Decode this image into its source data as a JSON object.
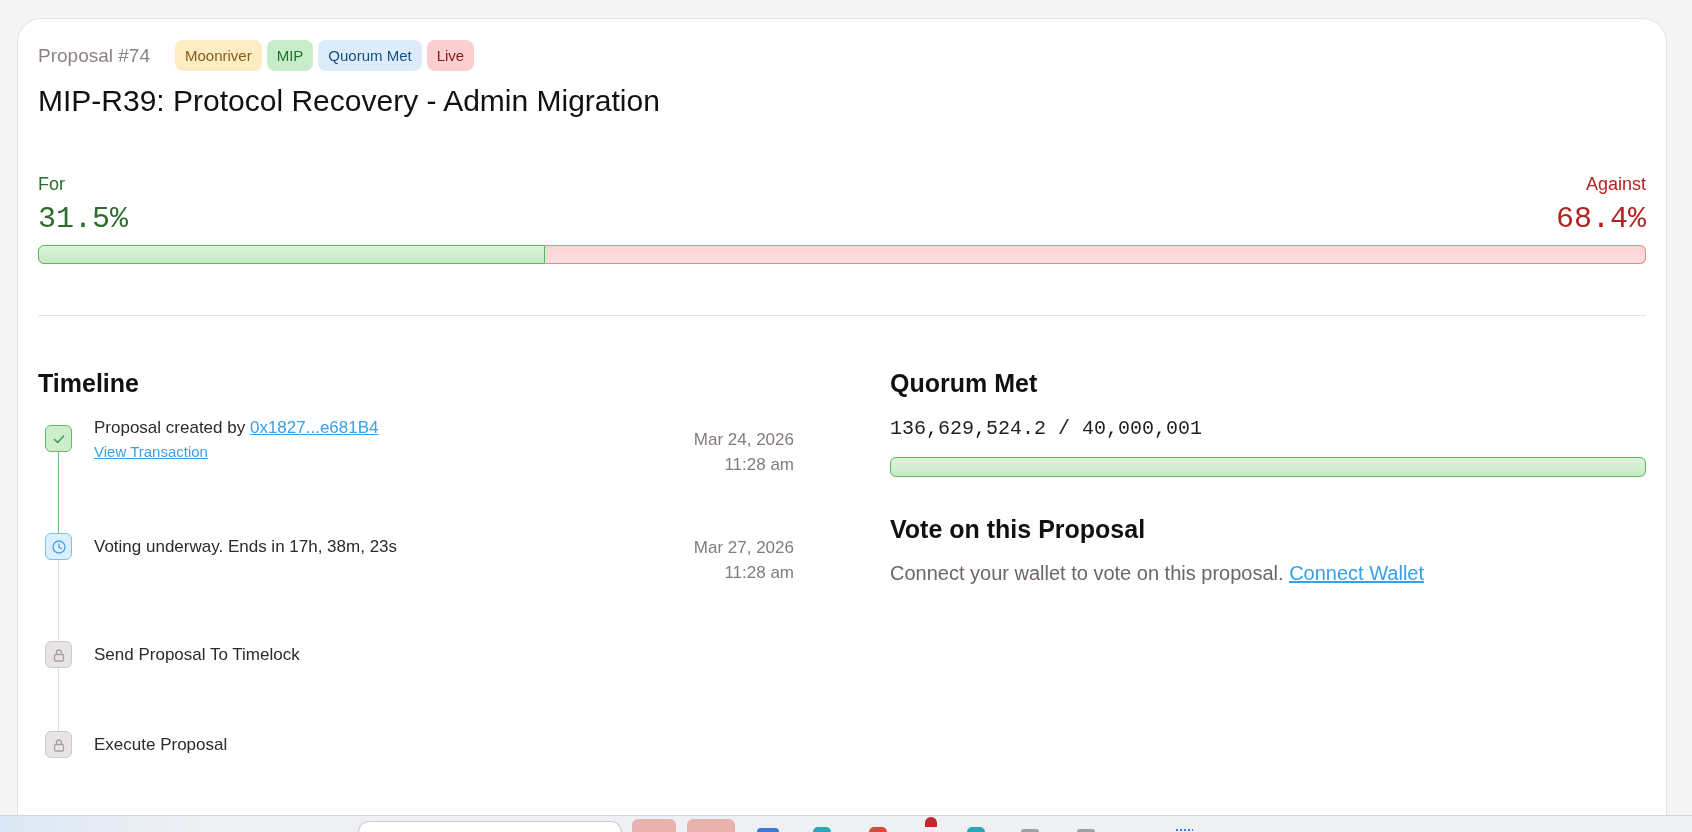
{
  "header": {
    "proposal_number": "Proposal #74",
    "tags": [
      {
        "label": "Moonriver",
        "color": "#fdebc4"
      },
      {
        "label": "MIP",
        "color": "#c6ecc9"
      },
      {
        "label": "Quorum Met",
        "color": "#dcecfb"
      },
      {
        "label": "Live",
        "color": "#fbcfcf"
      }
    ],
    "title": "MIP-R39: Protocol Recovery - Admin Migration"
  },
  "votes": {
    "for": {
      "label": "For",
      "percent": "31.5%",
      "level": 0.315
    },
    "against": {
      "label": "Against",
      "percent": "68.4%",
      "level": 0.684
    }
  },
  "timeline": {
    "title": "Timeline",
    "steps": [
      {
        "kind": "done",
        "text": "Proposal created by",
        "link": "0x1827...e681B4",
        "sublink": "View Transaction",
        "date": "Mar 24, 2026",
        "time": "11:28 am"
      },
      {
        "kind": "active",
        "text": "Voting underway. Ends in 17h, 38m, 23s",
        "date": "Mar 27, 2026",
        "time": "11:28 am"
      },
      {
        "kind": "locked",
        "text": "Send Proposal To Timelock"
      },
      {
        "kind": "locked",
        "text": "Execute Proposal"
      }
    ]
  },
  "quorum": {
    "title": "Quorum Met",
    "reading": "136,629,524.2 / 40,000,001",
    "level": 1
  },
  "vote": {
    "title": "Vote on this Proposal",
    "text": "Connect your wallet to vote on this proposal.",
    "link": "Connect Wallet"
  }
}
